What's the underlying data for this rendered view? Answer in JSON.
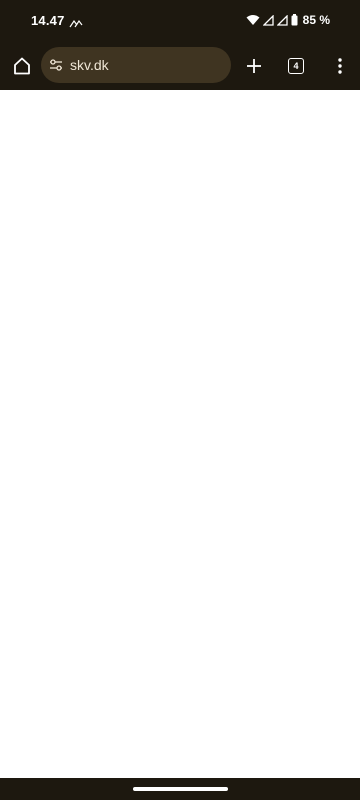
{
  "status_bar": {
    "time": "14.47",
    "battery_percent": "85 %",
    "icons": [
      "notification-icon",
      "wifi-icon",
      "signal-icon",
      "signal-icon",
      "battery-icon"
    ]
  },
  "toolbar": {
    "url": "skv.dk",
    "tab_count": "4",
    "icons": [
      "home-icon",
      "tune-icon",
      "plus-icon",
      "tab-switcher-icon",
      "more-vert-icon"
    ]
  },
  "colors": {
    "chrome_background": "#1d180f",
    "omnibox_background": "#3f3421",
    "page_background": "#ffffff"
  }
}
